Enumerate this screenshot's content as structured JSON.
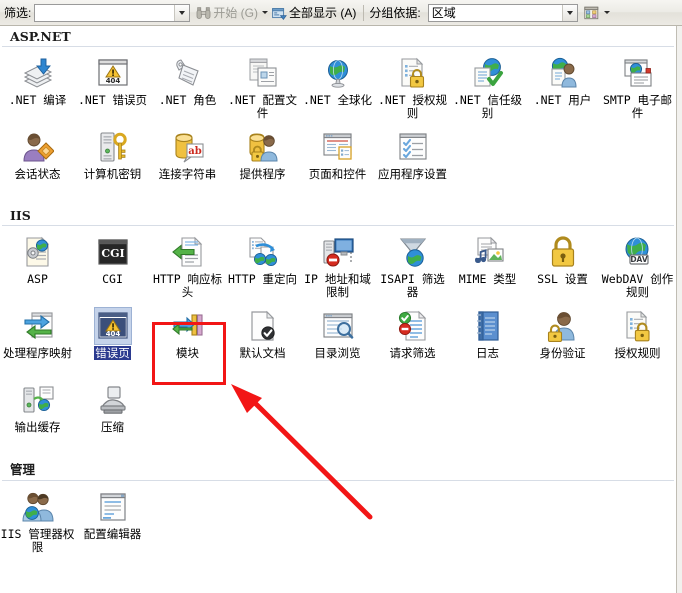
{
  "toolbar": {
    "filter_label": "筛选:",
    "filter_value": "",
    "filter_placeholder": "",
    "go_label": "开始 (G)",
    "show_all_label": "全部显示 (A)",
    "group_by_label": "分组依据:",
    "group_by_value": "区域",
    "go_icon": "binoculars-icon",
    "show_all_icon": "show-all-icon",
    "view_icon": "view-options-icon"
  },
  "groups": [
    {
      "title": "ASP.NET",
      "items": [
        {
          "label": ".NET 编译",
          "icon": "net-compilation-icon"
        },
        {
          "label": ".NET 错误页",
          "icon": "net-error-pages-icon"
        },
        {
          "label": ".NET 角色",
          "icon": "net-roles-icon"
        },
        {
          "label": ".NET 配置文件",
          "icon": "net-profile-icon"
        },
        {
          "label": ".NET 全球化",
          "icon": "net-globalization-icon"
        },
        {
          "label": ".NET 授权规则",
          "icon": "net-authorization-rules-icon"
        },
        {
          "label": ".NET 信任级别",
          "icon": "net-trust-levels-icon"
        },
        {
          "label": ".NET 用户",
          "icon": "net-users-icon"
        },
        {
          "label": "SMTP 电子邮件",
          "icon": "smtp-email-icon"
        },
        {
          "label": "会话状态",
          "icon": "session-state-icon"
        },
        {
          "label": "计算机密钥",
          "icon": "machine-key-icon"
        },
        {
          "label": "连接字符串",
          "icon": "connection-strings-icon"
        },
        {
          "label": "提供程序",
          "icon": "providers-icon"
        },
        {
          "label": "页面和控件",
          "icon": "pages-and-controls-icon"
        },
        {
          "label": "应用程序设置",
          "icon": "application-settings-icon"
        }
      ]
    },
    {
      "title": "IIS",
      "items": [
        {
          "label": "ASP",
          "icon": "asp-icon"
        },
        {
          "label": "CGI",
          "icon": "cgi-icon"
        },
        {
          "label": "HTTP 响应标头",
          "icon": "http-response-headers-icon"
        },
        {
          "label": "HTTP 重定向",
          "icon": "http-redirect-icon"
        },
        {
          "label": "IP 地址和域限制",
          "icon": "ip-address-domain-restrictions-icon"
        },
        {
          "label": "ISAPI 筛选器",
          "icon": "isapi-filters-icon"
        },
        {
          "label": "MIME 类型",
          "icon": "mime-types-icon"
        },
        {
          "label": "SSL 设置",
          "icon": "ssl-settings-icon"
        },
        {
          "label": "WebDAV 创作规则",
          "icon": "webdav-authoring-rules-icon"
        },
        {
          "label": "处理程序映射",
          "icon": "handler-mappings-icon"
        },
        {
          "label": "错误页",
          "icon": "error-pages-icon",
          "selected": true
        },
        {
          "label": "模块",
          "icon": "modules-icon"
        },
        {
          "label": "默认文档",
          "icon": "default-document-icon"
        },
        {
          "label": "目录浏览",
          "icon": "directory-browsing-icon"
        },
        {
          "label": "请求筛选",
          "icon": "request-filtering-icon"
        },
        {
          "label": "日志",
          "icon": "logging-icon"
        },
        {
          "label": "身份验证",
          "icon": "authentication-icon"
        },
        {
          "label": "授权规则",
          "icon": "authorization-rules-icon"
        },
        {
          "label": "输出缓存",
          "icon": "output-caching-icon"
        },
        {
          "label": "压缩",
          "icon": "compression-icon"
        }
      ]
    },
    {
      "title": "管理",
      "items": [
        {
          "label": "IIS 管理器权限",
          "icon": "iis-manager-permissions-icon"
        },
        {
          "label": "配置编辑器",
          "icon": "configuration-editor-icon"
        }
      ]
    }
  ],
  "annotation": {
    "highlight_color": "#f21616",
    "arrow_color": "#f21616",
    "target_label": "错误页"
  }
}
